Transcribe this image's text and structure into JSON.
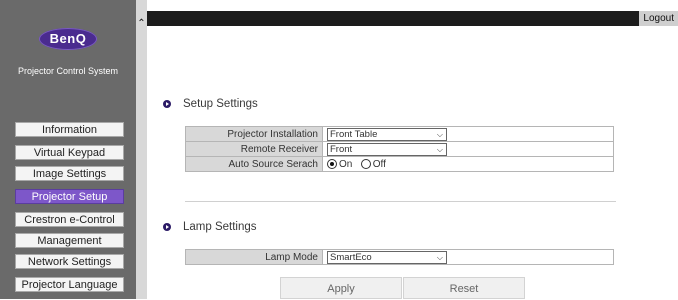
{
  "brand": {
    "logo_text": "BenQ",
    "subtitle": "Projector Control System"
  },
  "topbar": {
    "logout_label": "Logout"
  },
  "sidebar": {
    "items": [
      {
        "label": "Information",
        "active": false
      },
      {
        "label": "Virtual Keypad",
        "active": false
      },
      {
        "label": "Image Settings",
        "active": false
      },
      {
        "label": "Projector Setup",
        "active": true
      },
      {
        "label": "Crestron e-Control",
        "active": false
      },
      {
        "label": "Management",
        "active": false
      },
      {
        "label": "Network Settings",
        "active": false
      },
      {
        "label": "Projector Language",
        "active": false
      }
    ]
  },
  "setup": {
    "title": "Setup Settings",
    "installation_label": "Projector Installation",
    "installation_value": "Front Table",
    "receiver_label": "Remote Receiver",
    "receiver_value": "Front",
    "auto_source_label": "Auto Source Serach",
    "auto_source_on": "On",
    "auto_source_off": "Off",
    "auto_source_selected": "On"
  },
  "lamp": {
    "title": "Lamp Settings",
    "mode_label": "Lamp Mode",
    "mode_value": "SmartEco"
  },
  "actions": {
    "apply_label": "Apply",
    "reset_label": "Reset"
  },
  "colors": {
    "active_menu": "#7d57c9",
    "sidebar_bg": "#6a6a6a",
    "topbar_bg": "#1c1c1c",
    "brand_purple": "#4a2b8f"
  }
}
